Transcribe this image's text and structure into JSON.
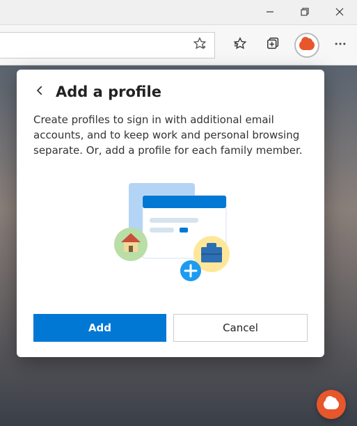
{
  "dialog": {
    "title": "Add a profile",
    "description": "Create profiles to sign in with additional email accounts, and to keep work and personal browsing separate. Or, add a profile for each family member.",
    "add_label": "Add",
    "cancel_label": "Cancel"
  },
  "colors": {
    "primary": "#0078d4",
    "accent": "#e8562b"
  }
}
